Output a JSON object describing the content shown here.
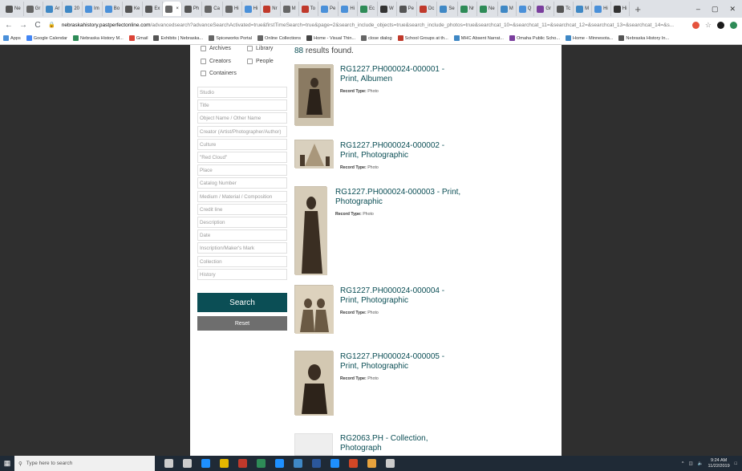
{
  "browser": {
    "tabs": [
      {
        "label": "Ne",
        "color": "#555555"
      },
      {
        "label": "Gr",
        "color": "#666666"
      },
      {
        "label": "Ar",
        "color": "#3f88c5"
      },
      {
        "label": "20",
        "color": "#3f88c5"
      },
      {
        "label": "Im",
        "color": "#4a90d9"
      },
      {
        "label": "Bo",
        "color": "#4a90d9"
      },
      {
        "label": "Ke",
        "color": "#555555"
      },
      {
        "label": "Ex",
        "color": "#555555"
      },
      {
        "label": "",
        "color": "#666666"
      },
      {
        "label": "Ph",
        "color": "#555555"
      },
      {
        "label": "Ca",
        "color": "#666666"
      },
      {
        "label": "Hi",
        "color": "#666666"
      },
      {
        "label": "Hi",
        "color": "#4a90d9"
      },
      {
        "label": "Nr",
        "color": "#c0392b"
      },
      {
        "label": "M",
        "color": "#666666"
      },
      {
        "label": "To",
        "color": "#c0392b"
      },
      {
        "label": "Pe",
        "color": "#4a90d9"
      },
      {
        "label": "Hi",
        "color": "#4a90d9"
      },
      {
        "label": "Ec",
        "color": "#2e8b57"
      },
      {
        "label": "W",
        "color": "#333333"
      },
      {
        "label": "Pe",
        "color": "#555555"
      },
      {
        "label": "Dc",
        "color": "#c0392b"
      },
      {
        "label": "Se",
        "color": "#3f88c5"
      },
      {
        "label": "Nr",
        "color": "#2e8b57"
      },
      {
        "label": "Ne",
        "color": "#2e8b57"
      },
      {
        "label": "M",
        "color": "#3f88c5"
      },
      {
        "label": "Q",
        "color": "#4a90d9"
      },
      {
        "label": "Gr",
        "color": "#7a3e9d"
      },
      {
        "label": "Tc",
        "color": "#555555"
      },
      {
        "label": "M",
        "color": "#3f88c5"
      },
      {
        "label": "Hi",
        "color": "#4a90d9"
      },
      {
        "label": "Hi",
        "color": "#333333"
      }
    ],
    "active_tab_index": 8,
    "new_tab": "+",
    "window_controls": [
      "–",
      "▢",
      "✕"
    ],
    "back": "←",
    "forward": "→",
    "reload": "C",
    "url_host": "nebraskahistory.pastperfectonline.com",
    "url_rest": "/advancedsearch?advanceSearchActivated=true&firstTimeSearch=true&page=2&search_include_objects=true&search_include_photos=true&searchcat_10=&searchcat_11=&searchcat_12=&searchcat_13=&searchcat_14=&s...",
    "bookmarks": [
      {
        "label": "Apps",
        "color": "#4a90d9"
      },
      {
        "label": "Google Calendar",
        "color": "#4285f4"
      },
      {
        "label": "Nebraska History M...",
        "color": "#2e8b57"
      },
      {
        "label": "Gmail",
        "color": "#db4437"
      },
      {
        "label": "Exhibits | Nebraska...",
        "color": "#555555"
      },
      {
        "label": "Spiceworks Portal",
        "color": "#666666"
      },
      {
        "label": "Online Collections",
        "color": "#666666"
      },
      {
        "label": "Home - Visual Thin...",
        "color": "#444444"
      },
      {
        "label": "close dialog",
        "color": "#666666"
      },
      {
        "label": "School Groups at th...",
        "color": "#c0392b"
      },
      {
        "label": "MHC Absent Narrat...",
        "color": "#3f88c5"
      },
      {
        "label": "Omaha Public Scho...",
        "color": "#7a3e9d"
      },
      {
        "label": "Home - Minnesota...",
        "color": "#3f88c5"
      },
      {
        "label": "Nebraska History In...",
        "color": "#555555"
      }
    ]
  },
  "search_form": {
    "checkboxes": [
      {
        "label": "Archives"
      },
      {
        "label": "Library"
      },
      {
        "label": "Creators"
      },
      {
        "label": "People"
      },
      {
        "label": "Containers"
      }
    ],
    "fields": [
      {
        "placeholder": "Studio"
      },
      {
        "placeholder": "Title"
      },
      {
        "placeholder": "Object Name / Other Name"
      },
      {
        "placeholder": "Creator (Artist/Photographer/Author)"
      },
      {
        "placeholder": "Culture"
      },
      {
        "placeholder": "\"Red Cloud\""
      },
      {
        "placeholder": "Place"
      },
      {
        "placeholder": "Catalog Number"
      },
      {
        "placeholder": "Medium / Material / Composition"
      },
      {
        "placeholder": "Credit line"
      },
      {
        "placeholder": "Description"
      },
      {
        "placeholder": "Date"
      },
      {
        "placeholder": "Inscription/Maker's Mark"
      },
      {
        "placeholder": "Collection"
      },
      {
        "placeholder": "History"
      }
    ],
    "search_label": "Search",
    "reset_label": "Reset"
  },
  "results": {
    "count": "88",
    "count_suffix": " results found.",
    "type_label": "Record Type:",
    "items": [
      {
        "title_line1": "RG1227.PH000024-000001 -",
        "title_line2": "Print, Albumen",
        "record_type": "Photo"
      },
      {
        "title_line1": "RG1227.PH000024-000002 -",
        "title_line2": "Print, Photographic",
        "record_type": "Photo"
      },
      {
        "title_line1": "RG1227.PH000024-000003 - Print,",
        "title_line2": "Photographic",
        "record_type": "Photo"
      },
      {
        "title_line1": "RG1227.PH000024-000004 -",
        "title_line2": "Print, Photographic",
        "record_type": "Photo"
      },
      {
        "title_line1": "RG1227.PH000024-000005 -",
        "title_line2": "Print, Photographic",
        "record_type": "Photo"
      },
      {
        "title_line1": "RG2063.PH - Collection,",
        "title_line2": "Photograph",
        "record_type": ""
      }
    ]
  },
  "taskbar": {
    "search_placeholder": "Type here to search",
    "time": "9:24 AM",
    "date": "11/22/2019",
    "app_colors": [
      "#cccccc",
      "#cccccc",
      "#1e90ff",
      "#e6b800",
      "#c0392b",
      "#2e8b57",
      "#1e90ff",
      "#3f88c5",
      "#2b579a",
      "#1e90ff",
      "#d24726",
      "#e8a33d",
      "#cccccc"
    ]
  }
}
